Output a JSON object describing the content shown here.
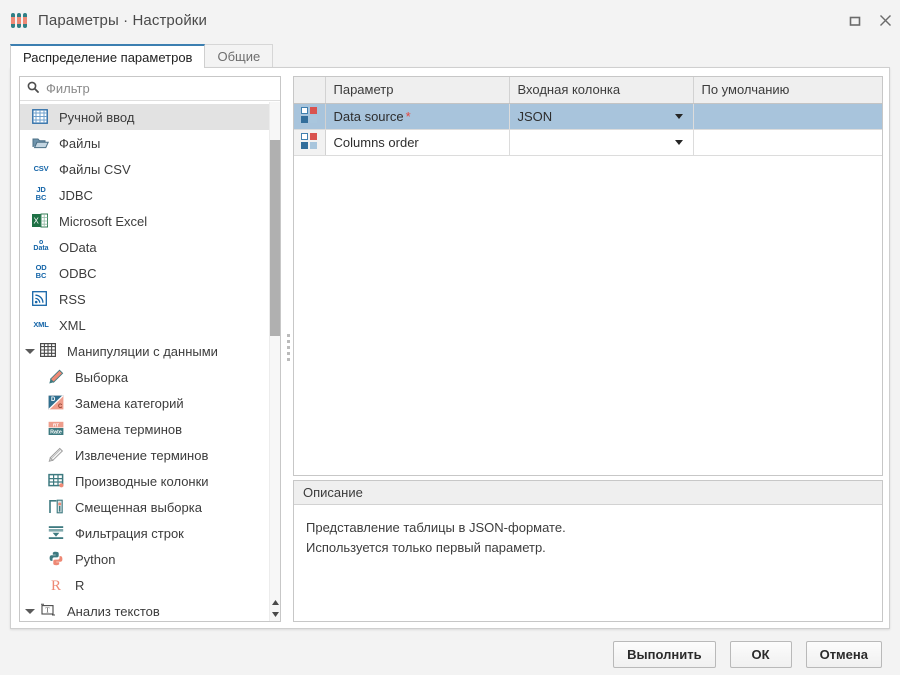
{
  "window": {
    "title": "Параметры · Настройки",
    "icon": "parameters-icon",
    "maximize_label": "Развернуть",
    "close_label": "Закрыть"
  },
  "tabs": [
    {
      "label": "Распределение параметров",
      "active": true
    },
    {
      "label": "Общие",
      "active": false
    }
  ],
  "sidebar": {
    "filter": {
      "placeholder": "Фильтр",
      "value": ""
    },
    "items": [
      {
        "label": "Ручной ввод",
        "icon": "table-grid-icon",
        "kind": "leaf",
        "selected": true
      },
      {
        "label": "Файлы",
        "icon": "folder-open-icon",
        "kind": "leaf",
        "selected": false
      },
      {
        "label": "Файлы CSV",
        "icon": "csv-icon",
        "kind": "leaf",
        "selected": false
      },
      {
        "label": "JDBC",
        "icon": "jdbc-icon",
        "kind": "leaf",
        "selected": false
      },
      {
        "label": "Microsoft Excel",
        "icon": "excel-icon",
        "kind": "leaf",
        "selected": false
      },
      {
        "label": "OData",
        "icon": "odata-icon",
        "kind": "leaf",
        "selected": false
      },
      {
        "label": "ODBC",
        "icon": "odbc-icon",
        "kind": "leaf",
        "selected": false
      },
      {
        "label": "RSS",
        "icon": "rss-icon",
        "kind": "leaf",
        "selected": false
      },
      {
        "label": "XML",
        "icon": "xml-icon",
        "kind": "leaf",
        "selected": false
      },
      {
        "label": "Манипуляции с данными",
        "icon": "data-table-icon",
        "kind": "group",
        "selected": false
      },
      {
        "label": "Выборка",
        "icon": "pen-icon",
        "kind": "leaf",
        "selected": false
      },
      {
        "label": "Замена категорий",
        "icon": "replace-category-icon",
        "kind": "leaf",
        "selected": false
      },
      {
        "label": "Замена терминов",
        "icon": "replace-terms-icon",
        "kind": "leaf",
        "selected": false
      },
      {
        "label": "Извлечение терминов",
        "icon": "extract-terms-icon",
        "kind": "leaf",
        "selected": false
      },
      {
        "label": "Производные колонки",
        "icon": "derived-columns-icon",
        "kind": "leaf",
        "selected": false
      },
      {
        "label": "Смещенная выборка",
        "icon": "biased-sample-icon",
        "kind": "leaf",
        "selected": false
      },
      {
        "label": "Фильтрация строк",
        "icon": "row-filter-icon",
        "kind": "leaf",
        "selected": false
      },
      {
        "label": "Python",
        "icon": "python-icon",
        "kind": "leaf",
        "selected": false
      },
      {
        "label": "R",
        "icon": "r-icon",
        "kind": "leaf",
        "selected": false
      },
      {
        "label": "Анализ текстов",
        "icon": "text-analysis-icon",
        "kind": "group",
        "selected": false
      }
    ]
  },
  "grid": {
    "columns": [
      "Параметр",
      "Входная колонка",
      "По умолчанию"
    ],
    "rows": [
      {
        "icon": "parameter-squares-icon",
        "parameter": "Data source",
        "required": "*",
        "input_column": "JSON",
        "default": "",
        "selected": true
      },
      {
        "icon": "parameter-squares-icon",
        "parameter": "Columns order",
        "required": "",
        "input_column": "",
        "default": "",
        "selected": false
      }
    ]
  },
  "description": {
    "title": "Описание",
    "line1": "Представление таблицы в JSON-формате.",
    "line2": "Используется только первый параметр."
  },
  "footer": {
    "run": "Выполнить",
    "ok": "ОК",
    "cancel": "Отмена"
  },
  "colors": {
    "accent": "#3c7fb1",
    "selection_row": "#a8c4dc",
    "selection_tree": "#e2e2e2",
    "required_mark": "#e8453c",
    "header_bg": "#efefef",
    "window_bg": "#f3f3f3"
  }
}
